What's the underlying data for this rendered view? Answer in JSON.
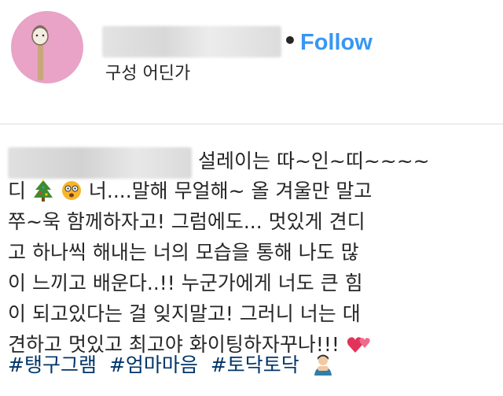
{
  "header": {
    "separator": "•",
    "follow_label": "Follow",
    "location": "구성 어딘가"
  },
  "caption": {
    "line1": "설레이는 따~인~띠~~~~",
    "line2_start": "디",
    "line2_end": "너....말해 무얼해~ 올 겨울만 말고",
    "line3": "쭈~욱 함께하자고! 그럼에도... 멋있게 견디",
    "line4": "고 하나씩 해내는 너의 모습을 통해 나도 많",
    "line5": "이 느끼고 배운다..!! 누군가에게 너도 큰 힘",
    "line6": "이 되고있다는 걸 잊지말고! 그러니 너는 대",
    "line7": "견하고 멋있고 최고야 화이팅하자꾸나!!!",
    "hashtags": [
      "#탱구그램",
      "#엄마마음",
      "#토닥토닥"
    ]
  },
  "icons": {
    "emoji_1": "christmas-tree-icon",
    "emoji_2": "dizzy-face-icon",
    "emoji_3": "two-hearts-icon",
    "emoji_4": "person-icon"
  },
  "colors": {
    "follow": "#3897f0",
    "hashtag": "#003569",
    "avatar_bg": "#e8a3c7"
  }
}
